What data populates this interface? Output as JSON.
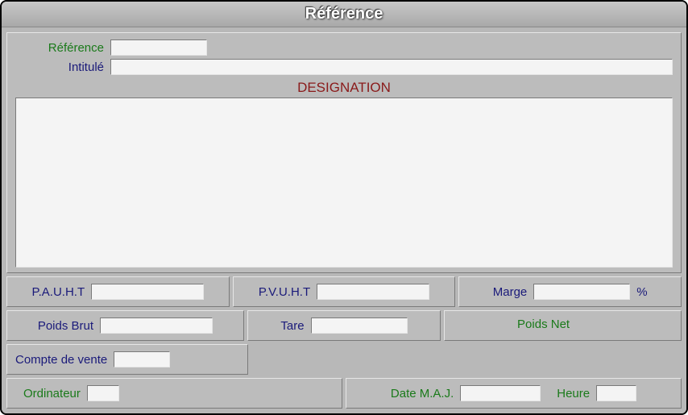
{
  "window": {
    "title": "Référence"
  },
  "top": {
    "reference_label": "Référence",
    "intitule_label": "Intitulé",
    "reference_value": "",
    "intitule_value": ""
  },
  "designation": {
    "legend": "DESIGNATION",
    "value": ""
  },
  "prices": {
    "pauht_label": "P.A.U.H.T",
    "pauht_value": "",
    "pvuht_label": "P.V.U.H.T",
    "pvuht_value": "",
    "marge_label": "Marge",
    "marge_value": "",
    "marge_suffix": "%"
  },
  "weights": {
    "poids_brut_label": "Poids Brut",
    "poids_brut_value": "",
    "tare_label": "Tare",
    "tare_value": "",
    "poids_net_label": "Poids Net",
    "poids_net_value": ""
  },
  "account": {
    "compte_vente_label": "Compte de vente",
    "compte_vente_value": ""
  },
  "meta": {
    "ordinateur_label": "Ordinateur",
    "ordinateur_value": "",
    "date_maj_label": "Date M.A.J.",
    "date_maj_value": "",
    "heure_label": "Heure",
    "heure_value": ""
  }
}
